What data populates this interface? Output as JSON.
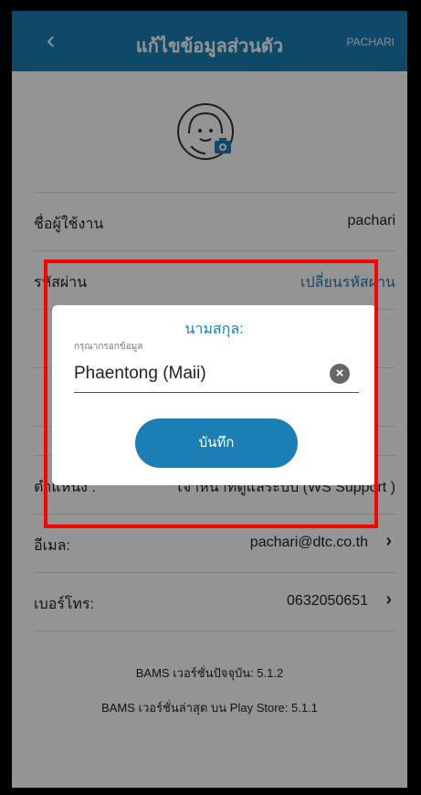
{
  "appbar": {
    "back_icon": "chevron-left-icon",
    "title": "แก้ไขข้อมูลส่วนตัว",
    "user": "PACHARI"
  },
  "profile": {
    "avatar_icon": "user-avatar-with-camera-icon",
    "rows": [
      {
        "label": "ชื่อผู้ใช้งาน",
        "value": ""
      },
      {
        "label": "รหัสผ่าน",
        "value": "เปลี่ยนรหัสผ่าน"
      },
      {
        "label": "ตำแหน่ง :",
        "value": "เจ้าหน้าที่ดูแลระบบ (WS Support )"
      },
      {
        "label": "อีเมล:",
        "value": "pachari@dtc.co.th"
      },
      {
        "label": "เบอร์โทร:",
        "value": "0632050651"
      }
    ],
    "username_value": "pachari"
  },
  "versions": {
    "current": "BAMS เวอร์ชั่นปัจจุบัน: 5.1.2",
    "latest": "BAMS เวอร์ชั่นล่าสุด บน Play Store: 5.1.1"
  },
  "dialog": {
    "title": "นามสกุล:",
    "hint": "กรุณากรอกข้อมูล",
    "input_value": "Phaentong (Maii)",
    "clear_icon": "clear-circle-icon",
    "save_label": "บันทึก"
  },
  "colors": {
    "primary": "#1b7fb6",
    "highlight": "#ff0000"
  }
}
